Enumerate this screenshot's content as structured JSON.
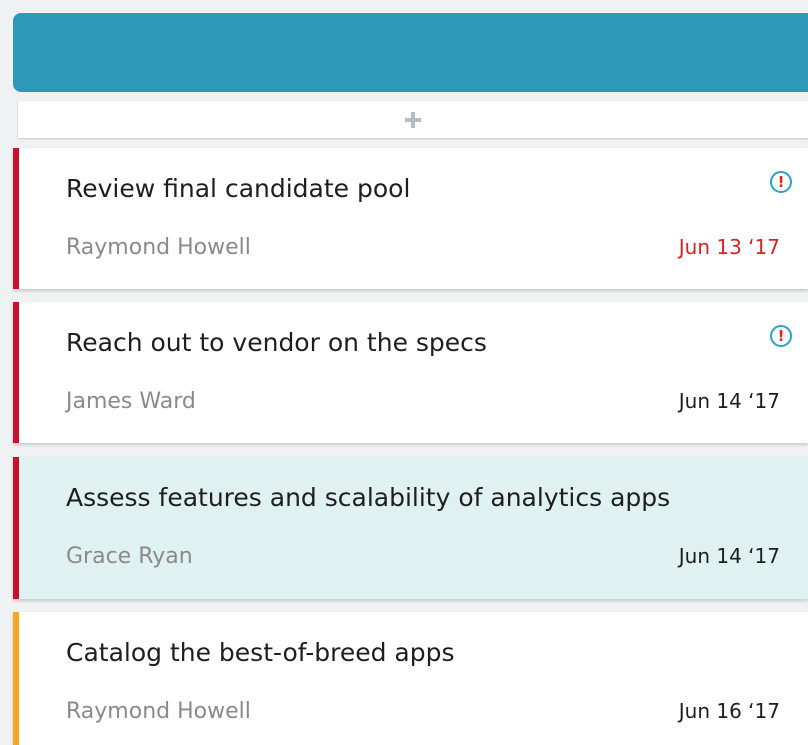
{
  "column": {
    "header_color": "#2e98b8",
    "add_icon": "plus-icon"
  },
  "cards": [
    {
      "title": "Review final candidate pool",
      "assignee": "Raymond Howell",
      "due": "Jun 13 ‘17",
      "overdue": true,
      "priority_icon": "!",
      "stripe_color": "#c8102e",
      "selected": false
    },
    {
      "title": "Reach out to vendor on the specs",
      "assignee": "James Ward",
      "due": "Jun 14 ‘17",
      "overdue": false,
      "priority_icon": "!",
      "stripe_color": "#c8102e",
      "selected": false
    },
    {
      "title": "Assess features and scalability of analytics apps",
      "assignee": "Grace Ryan",
      "due": "Jun 14 ‘17",
      "overdue": false,
      "stripe_color": "#c8102e",
      "selected": true
    },
    {
      "title": "Catalog the best-of-breed apps",
      "assignee": "Raymond Howell",
      "due": "Jun 16 ‘17",
      "overdue": false,
      "stripe_color": "#f5a623",
      "selected": false
    }
  ]
}
